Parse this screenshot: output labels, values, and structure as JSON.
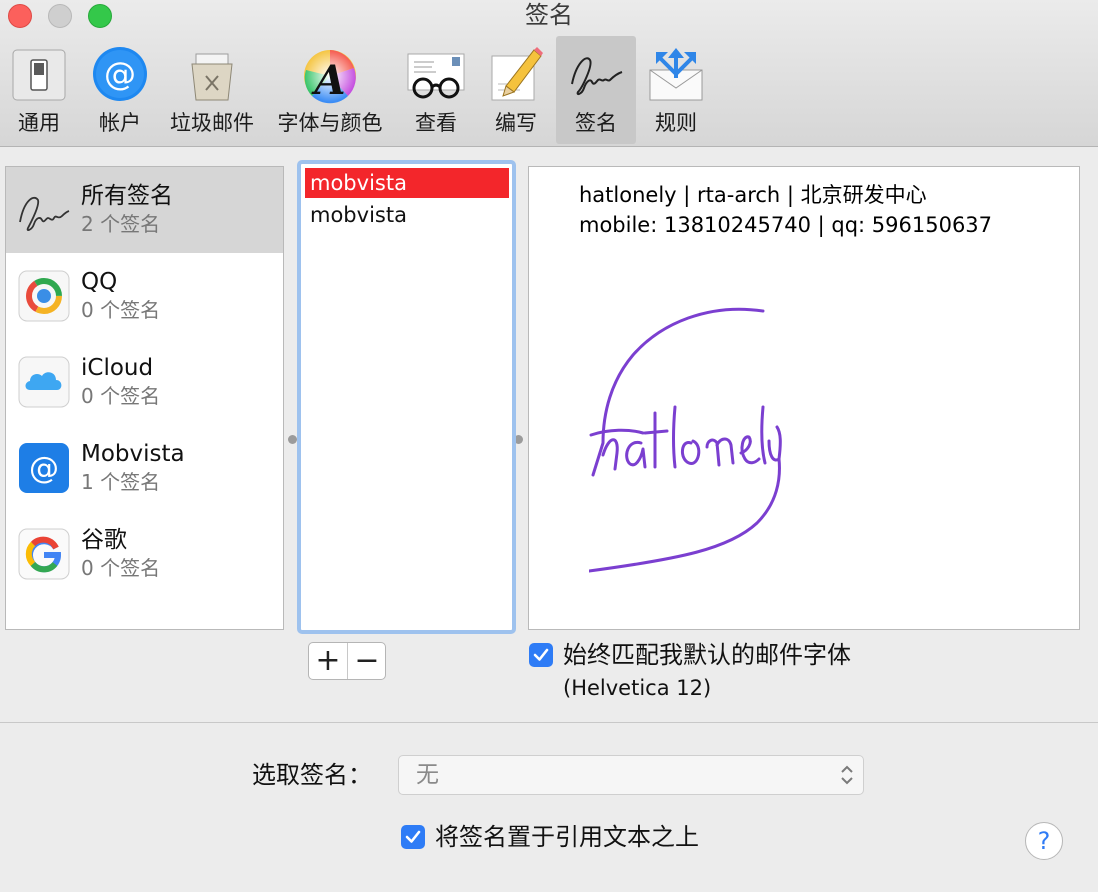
{
  "window": {
    "title": "签名"
  },
  "toolbar": {
    "items": [
      {
        "label": "通用",
        "icon": "general-switch-icon"
      },
      {
        "label": "帐户",
        "icon": "at-sign-icon"
      },
      {
        "label": "垃圾邮件",
        "icon": "trash-bin-icon"
      },
      {
        "label": "字体与颜色",
        "icon": "font-color-wheel-icon"
      },
      {
        "label": "查看",
        "icon": "viewing-glasses-icon"
      },
      {
        "label": "编写",
        "icon": "composing-pencil-icon"
      },
      {
        "label": "签名",
        "icon": "signature-icon"
      },
      {
        "label": "规则",
        "icon": "rules-envelope-icon"
      }
    ],
    "selected": "签名"
  },
  "accounts": [
    {
      "name": "所有签名",
      "count": "2 个签名",
      "icon": "signature-icon",
      "selected": true
    },
    {
      "name": "QQ",
      "count": "0 个签名",
      "icon": "qq-mail-icon"
    },
    {
      "name": "iCloud",
      "count": "0 个签名",
      "icon": "icloud-icon"
    },
    {
      "name": "Mobvista",
      "count": "1 个签名",
      "icon": "at-sign-icon"
    },
    {
      "name": "谷歌",
      "count": "0 个签名",
      "icon": "google-icon"
    }
  ],
  "signatures": [
    {
      "name": "mobvista",
      "selected": true
    },
    {
      "name": "mobvista",
      "selected": false
    }
  ],
  "preview": {
    "line1": "hatlonely | rta-arch | 北京研发中心",
    "line2": "mobile: 13810245740 | qq: 596150637",
    "handwritten_signature": "hatlonely"
  },
  "buttons": {
    "add": "+",
    "remove": "−",
    "help": "?"
  },
  "options": {
    "match_font_label": "始终匹配我默认的邮件字体",
    "match_font_checked": true,
    "font_hint": "(Helvetica 12)",
    "place_above_label": "将签名置于引用文本之上",
    "place_above_checked": true
  },
  "choose_signature": {
    "label": "选取签名：",
    "value": "无"
  },
  "colors": {
    "selection_red": "#f3262b",
    "accent_blue": "#2e7cf6",
    "signature_ink": "#7b3fd0"
  }
}
